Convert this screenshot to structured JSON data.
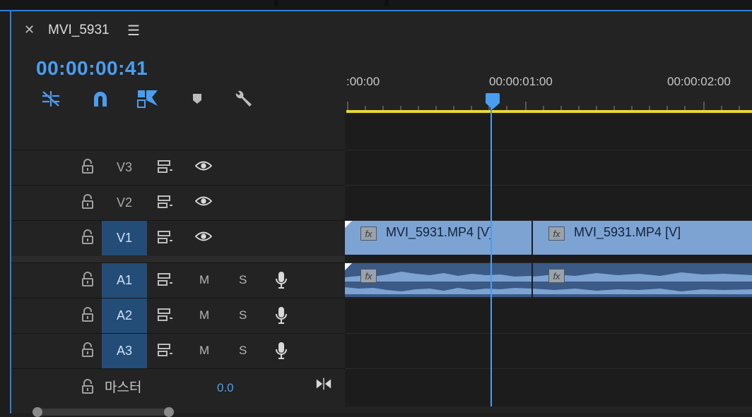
{
  "sequence": {
    "title": "MVI_5931",
    "timecode": "00:00:00:41"
  },
  "ruler": {
    "labels": [
      ":00:00",
      "00:00:01:00",
      "00:00:02:00"
    ]
  },
  "tracks": {
    "video": [
      {
        "name": "V3",
        "active": false
      },
      {
        "name": "V2",
        "active": false
      },
      {
        "name": "V1",
        "active": true
      }
    ],
    "audio": [
      {
        "name": "A1",
        "mute": "M",
        "solo": "S",
        "active": true
      },
      {
        "name": "A2",
        "mute": "M",
        "solo": "S",
        "active": true
      },
      {
        "name": "A3",
        "mute": "M",
        "solo": "S",
        "active": true
      }
    ],
    "master": {
      "label": "마스터",
      "value": "0.0"
    }
  },
  "clips": {
    "video": [
      {
        "label": "MVI_5931.MP4 [V]",
        "fx": "fx"
      },
      {
        "label": "MVI_5931.MP4 [V]",
        "fx": "fx"
      }
    ],
    "audio": [
      {
        "fx": "fx"
      },
      {
        "fx": "fx"
      }
    ]
  },
  "colors": {
    "accent": "#4a9ef0",
    "workarea": "#e8d83a",
    "video_clip": "#7da3d3",
    "audio_clip": "#3b5a85",
    "track_target": "#234d77"
  },
  "icons": {
    "close": "close-icon",
    "menu": "hamburger-menu-icon",
    "lock": "lock-open-icon",
    "sync": "sync-lock-icon",
    "eye": "eye-icon",
    "mic": "microphone-icon"
  }
}
